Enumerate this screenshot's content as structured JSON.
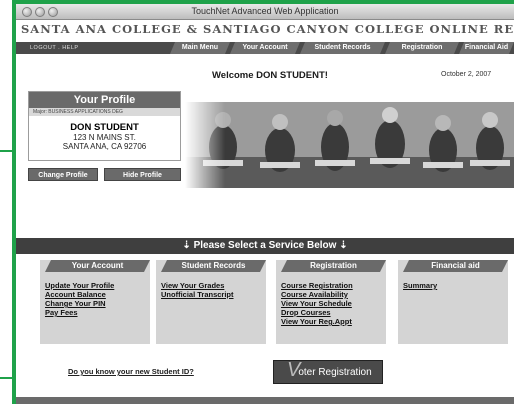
{
  "window": {
    "title": "TouchNet Advanced Web Application"
  },
  "banner": {
    "text": "SANTA ANA COLLEGE  &  SANTIAGO CANYON COLLEGE  ONLINE RECORDS SYSTEM"
  },
  "nav": {
    "util_links": "LOGOUT  .  HELP",
    "tabs": [
      "Main Menu",
      "Your Account",
      "Student Records",
      "Registration",
      "Financial Aid"
    ]
  },
  "welcome": {
    "text": "Welcome DON STUDENT!",
    "date": "October 2, 2007"
  },
  "profile": {
    "title": "Your Profile",
    "major": "Major: BUSINESS APPLICATIONS DEG",
    "name": "DON STUDENT",
    "address1": "123 N MAINS ST.",
    "address2": "SANTA ANA, CA 92706",
    "change_btn": "Change Profile",
    "hide_btn": "Hide Profile"
  },
  "services": {
    "header": "Please Select a Service Below",
    "cards": [
      {
        "title": "Your Account",
        "links": [
          "Update Your Profile",
          "Account Balance",
          "Change Your PIN",
          "Pay Fees"
        ]
      },
      {
        "title": "Student Records",
        "links": [
          "View Your Grades",
          "Unofficial Transcript"
        ]
      },
      {
        "title": "Registration",
        "links": [
          "Course Registration",
          "Course Availability",
          "View Your Schedule",
          "Drop Courses",
          "View Your Reg.Appt"
        ]
      },
      {
        "title": "Financial aid",
        "links": [
          "Summary"
        ]
      }
    ]
  },
  "bottom": {
    "student_id_link": "Do you know your new Student ID?",
    "voter_btn": "oter Registration",
    "voter_glyph": "V"
  },
  "colors": {
    "guide_green": "#1fa24a",
    "nav_dark": "#4a4a4a",
    "tab_gray": "#6e6e6e"
  }
}
